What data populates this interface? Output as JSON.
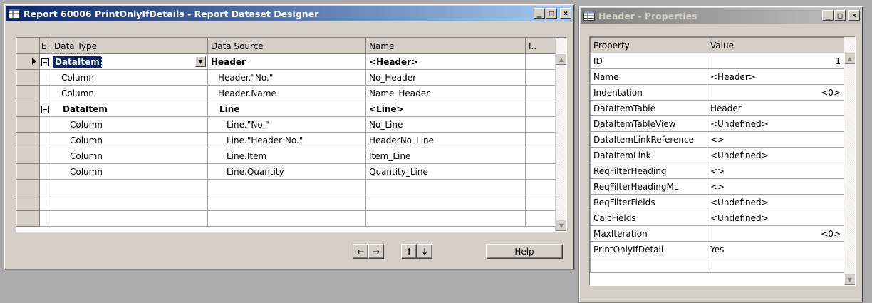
{
  "designer": {
    "title": "Report 60006 PrintOnlyIfDetails - Report Dataset Designer",
    "columns": {
      "expand": "E.",
      "data_type": "Data Type",
      "data_source": "Data Source",
      "name": "Name",
      "include": "I.."
    },
    "rows": [
      {
        "data_type": "DataItem",
        "data_source": "Header",
        "name": "<Header>",
        "level": 0,
        "kind": "dataitem"
      },
      {
        "data_type": "Column",
        "data_source": "Header.\"No.\"",
        "name": "No_Header",
        "level": 0,
        "kind": "column"
      },
      {
        "data_type": "Column",
        "data_source": "Header.Name",
        "name": "Name_Header",
        "level": 0,
        "kind": "column"
      },
      {
        "data_type": "DataItem",
        "data_source": "Line",
        "name": "<Line>",
        "level": 1,
        "kind": "dataitem"
      },
      {
        "data_type": "Column",
        "data_source": "Line.\"No.\"",
        "name": "No_Line",
        "level": 1,
        "kind": "column"
      },
      {
        "data_type": "Column",
        "data_source": "Line.\"Header No.\"",
        "name": "HeaderNo_Line",
        "level": 1,
        "kind": "column"
      },
      {
        "data_type": "Column",
        "data_source": "Line.Item",
        "name": "Item_Line",
        "level": 1,
        "kind": "column"
      },
      {
        "data_type": "Column",
        "data_source": "Line.Quantity",
        "name": "Quantity_Line",
        "level": 1,
        "kind": "column"
      }
    ],
    "buttons": {
      "left": "←",
      "right": "→",
      "up": "↑",
      "down": "↓",
      "help": "Help"
    }
  },
  "properties": {
    "title": "Header - Properties",
    "columns": {
      "property": "Property",
      "value": "Value"
    },
    "rows": [
      {
        "property": "ID",
        "value": "1",
        "align": "right"
      },
      {
        "property": "Name",
        "value": "<Header>",
        "align": "left"
      },
      {
        "property": "Indentation",
        "value": "<0>",
        "align": "right"
      },
      {
        "property": "DataItemTable",
        "value": "Header",
        "align": "left"
      },
      {
        "property": "DataItemTableView",
        "value": "<Undefined>",
        "align": "left"
      },
      {
        "property": "DataItemLinkReference",
        "value": "<>",
        "align": "left"
      },
      {
        "property": "DataItemLink",
        "value": "<Undefined>",
        "align": "left"
      },
      {
        "property": "ReqFilterHeading",
        "value": "<>",
        "align": "left"
      },
      {
        "property": "ReqFilterHeadingML",
        "value": "<>",
        "align": "left"
      },
      {
        "property": "ReqFilterFields",
        "value": "<Undefined>",
        "align": "left"
      },
      {
        "property": "CalcFields",
        "value": "<Undefined>",
        "align": "left"
      },
      {
        "property": "MaxIteration",
        "value": "<0>",
        "align": "right"
      },
      {
        "property": "PrintOnlyIfDetail",
        "value": "Yes",
        "align": "left"
      }
    ]
  },
  "window_buttons": {
    "minimize": "_",
    "maximize": "□",
    "close": "×"
  }
}
